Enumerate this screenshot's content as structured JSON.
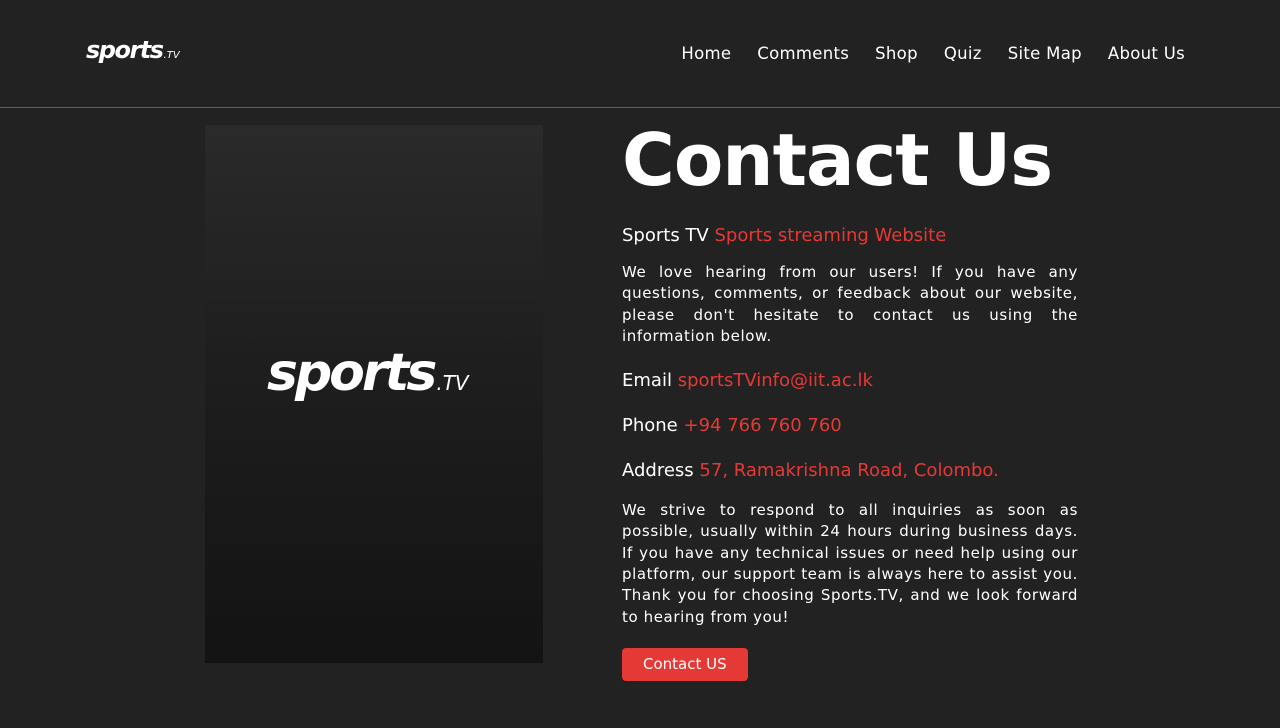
{
  "header": {
    "logo": {
      "word": "sports",
      "tld": ".TV"
    },
    "nav": [
      {
        "label": "Home"
      },
      {
        "label": "Comments"
      },
      {
        "label": "Shop"
      },
      {
        "label": "Quiz"
      },
      {
        "label": "Site Map"
      },
      {
        "label": "About Us"
      }
    ]
  },
  "poster": {
    "logo": {
      "word": "sports",
      "tld": ".TV"
    }
  },
  "main": {
    "title": "Contact Us",
    "subtitle": {
      "label": "Sports TV",
      "value": "Sports streaming Website"
    },
    "intro": "We love hearing from our users! If you have any questions, comments, or feedback about our website, please don't hesitate to contact us using the information below.",
    "email": {
      "label": "Email",
      "value": "sportsTVinfo@iit.ac.lk"
    },
    "phone": {
      "label": "Phone",
      "value": "+94 766 760 760"
    },
    "address": {
      "label": "Address",
      "value": "57, Ramakrishna Road, Colombo."
    },
    "outro": "We strive to respond to all inquiries as soon as possible, usually within 24 hours during business days. If you have any technical issues or need help using our platform, our support team is always here to assist you. Thank you for choosing Sports.TV, and we look forward to hearing from you!",
    "button": "Contact US"
  },
  "colors": {
    "background": "#222222",
    "accent": "#e53935",
    "divider": "#b83a3a"
  }
}
